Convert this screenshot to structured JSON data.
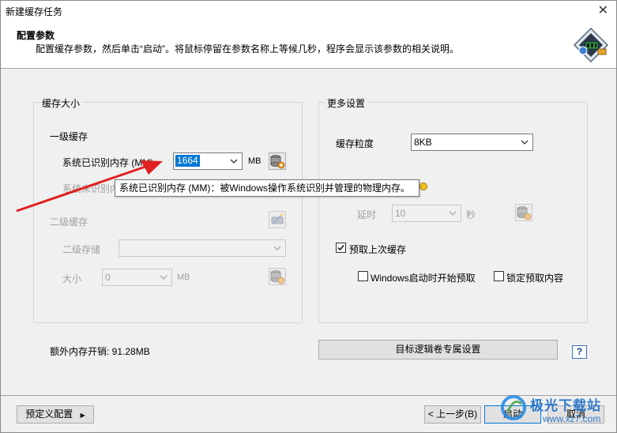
{
  "window": {
    "title": "新建缓存任务"
  },
  "header": {
    "title": "配置参数",
    "description": "配置缓存参数，然后单击“启动”。将鼠标停留在参数名称上等候几秒，程序会显示该参数的相关说明。"
  },
  "cache_size": {
    "legend": "缓存大小",
    "l1": {
      "heading": "一级缓存",
      "recognized_label": "系统已识别内存 (MM)",
      "recognized_value": "1664",
      "recognized_unit": "MB",
      "unrecognized_label": "系统未识别内存"
    },
    "l2": {
      "heading": "二级缓存",
      "storage_label": "二级存储",
      "storage_value": "",
      "size_label": "大小",
      "size_value": "0",
      "size_unit": "MB"
    }
  },
  "tooltip": {
    "text": "系统已识别内存 (MM)：被Windows操作系统识别并管理的物理内存。"
  },
  "more_settings": {
    "legend": "更多设置",
    "granularity_label": "缓存粒度",
    "granularity_value": "8KB",
    "delay_label": "延时",
    "delay_value": "10",
    "delay_unit": "秒",
    "prefetch_label": "预取上次缓存",
    "prefetch_checked": true,
    "start_prefetch_label": "Windows启动时开始预取",
    "start_prefetch_checked": false,
    "lock_prefetch_label": "锁定预取内容",
    "lock_prefetch_checked": false
  },
  "footer": {
    "extra_memory": "额外内存开销: 91.28MB",
    "target_volume_button": "目标逻辑卷专属设置",
    "help": "?",
    "predefined_button": "预定义配置",
    "back_button": "< 上一步(B)",
    "start_button": "启动",
    "cancel_button": "取消"
  },
  "watermark": {
    "brand": "极光下载站",
    "url": "www.xz7.com"
  }
}
